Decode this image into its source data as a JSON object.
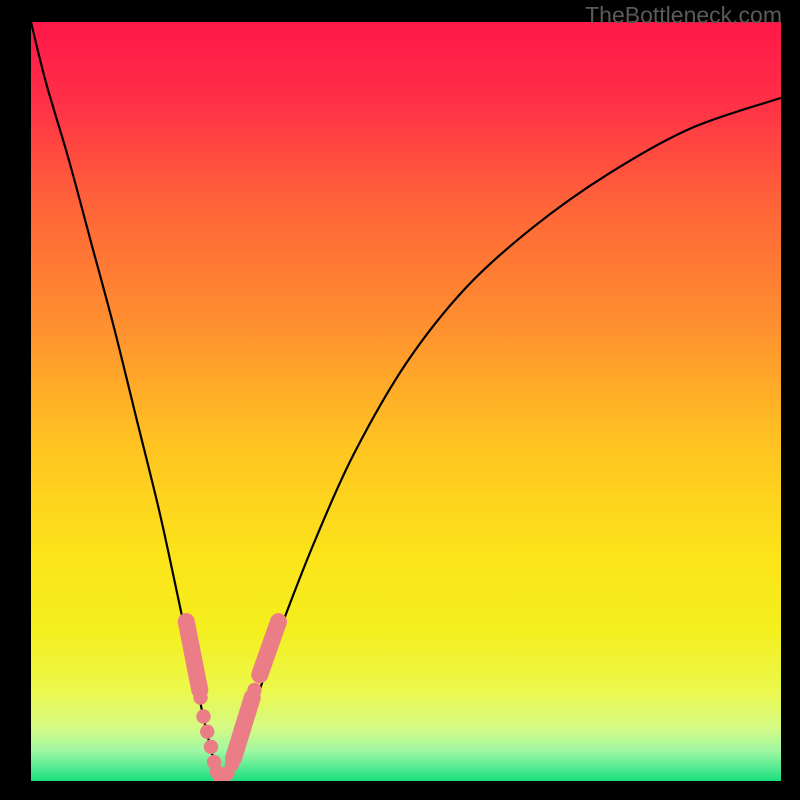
{
  "watermark": "TheBottleneck.com",
  "gradient": {
    "stops": [
      {
        "offset": 0.0,
        "color": "#ff1848"
      },
      {
        "offset": 0.1,
        "color": "#ff2e47"
      },
      {
        "offset": 0.25,
        "color": "#ff6738"
      },
      {
        "offset": 0.4,
        "color": "#ff9030"
      },
      {
        "offset": 0.55,
        "color": "#ffc222"
      },
      {
        "offset": 0.7,
        "color": "#fce31a"
      },
      {
        "offset": 0.8,
        "color": "#f4ef1e"
      },
      {
        "offset": 0.88,
        "color": "#ecf84b"
      },
      {
        "offset": 0.93,
        "color": "#d5fa85"
      },
      {
        "offset": 0.96,
        "color": "#a0f8a3"
      },
      {
        "offset": 0.985,
        "color": "#4de88f"
      },
      {
        "offset": 1.0,
        "color": "#1adf7d"
      }
    ]
  },
  "chart_data": {
    "type": "line",
    "title": "",
    "xlabel": "",
    "ylabel": "",
    "xlim": [
      0,
      100
    ],
    "ylim": [
      0,
      100
    ],
    "series": [
      {
        "name": "curve",
        "x": [
          0,
          2,
          5,
          8,
          11,
          14,
          17,
          19,
          20.5,
          22,
          23.3,
          24.3,
          24.9,
          25.4,
          26.0,
          27.0,
          28.0,
          29.5,
          31.5,
          34,
          38,
          43,
          50,
          58,
          67,
          77,
          88,
          100
        ],
        "y": [
          100,
          92,
          82,
          71,
          60,
          48,
          36,
          27,
          20,
          13,
          7,
          3,
          1,
          0.3,
          0.5,
          2,
          5,
          9,
          15,
          22,
          32,
          43,
          55,
          65,
          73,
          80,
          86,
          90
        ]
      }
    ],
    "clusters": [
      {
        "name": "left-cluster",
        "points": [
          {
            "x": 21.2,
            "y": 19
          },
          {
            "x": 21.7,
            "y": 16.5
          },
          {
            "x": 22.0,
            "y": 14
          },
          {
            "x": 22.6,
            "y": 11
          },
          {
            "x": 23.0,
            "y": 8.5
          },
          {
            "x": 23.5,
            "y": 6.5
          },
          {
            "x": 24.0,
            "y": 4.5
          },
          {
            "x": 24.4,
            "y": 2.5
          },
          {
            "x": 24.8,
            "y": 1.2
          }
        ]
      },
      {
        "name": "dip-cluster",
        "points": [
          {
            "x": 25.2,
            "y": 0.4
          },
          {
            "x": 25.7,
            "y": 0.5
          },
          {
            "x": 26.2,
            "y": 1.0
          }
        ]
      },
      {
        "name": "right-cluster",
        "points": [
          {
            "x": 26.8,
            "y": 2.2
          },
          {
            "x": 27.4,
            "y": 4.0
          },
          {
            "x": 27.9,
            "y": 5.5
          },
          {
            "x": 28.5,
            "y": 7.5
          },
          {
            "x": 29.1,
            "y": 9.5
          },
          {
            "x": 29.8,
            "y": 12.0
          },
          {
            "x": 30.8,
            "y": 15.0
          },
          {
            "x": 31.6,
            "y": 17.5
          },
          {
            "x": 32.5,
            "y": 20.0
          }
        ]
      }
    ],
    "pill_groups": [
      {
        "x1": 20.7,
        "y1": 21.0,
        "x2": 22.5,
        "y2": 12.0
      },
      {
        "x1": 27.0,
        "y1": 3.0,
        "x2": 29.5,
        "y2": 11.0
      },
      {
        "x1": 30.5,
        "y1": 14.0,
        "x2": 33.0,
        "y2": 21.0
      }
    ]
  },
  "point_color": "#eb7d86",
  "curve_color": "#000000"
}
